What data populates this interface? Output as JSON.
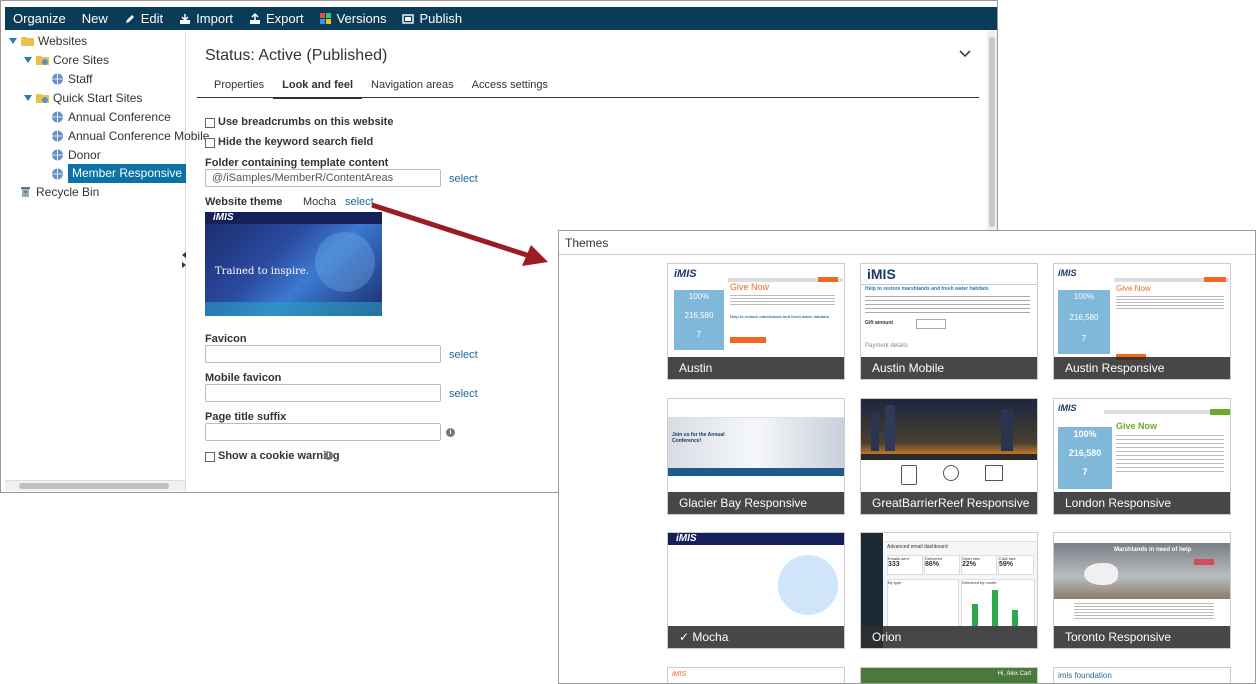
{
  "toolbar": {
    "organize": "Organize",
    "new": "New",
    "edit": "Edit",
    "import": "Import",
    "export": "Export",
    "versions": "Versions",
    "publish": "Publish"
  },
  "tree": {
    "websites": "Websites",
    "core_sites": "Core Sites",
    "staff": "Staff",
    "quick_start_sites": "Quick Start Sites",
    "annual_conference": "Annual Conference",
    "annual_conference_mobile": "Annual Conference Mobile",
    "donor": "Donor",
    "member_responsive": "Member Responsive",
    "recycle_bin": "Recycle Bin"
  },
  "status_title": "Status: Active (Published)",
  "tabs": [
    "Properties",
    "Look and feel",
    "Navigation areas",
    "Access settings"
  ],
  "form": {
    "breadcrumbs_label": "Use breadcrumbs on this website",
    "hide_search_label": "Hide the keyword search field",
    "folder_label": "Folder containing template content",
    "folder_value": "@/iSamples/MemberR/ContentAreas",
    "select": "select",
    "theme_label": "Website theme",
    "theme_value": "Mocha",
    "favicon_label": "Favicon",
    "mobile_favicon_label": "Mobile favicon",
    "page_title_suffix_label": "Page title suffix",
    "cookie_label": "Show a cookie warning"
  },
  "preview": {
    "logo": "iMIS",
    "headline": "Trained to inspire."
  },
  "themes_panel": {
    "title": "Themes",
    "cards": [
      {
        "name": "Austin"
      },
      {
        "name": "Austin Mobile"
      },
      {
        "name": "Austin Responsive"
      },
      {
        "name": "Glacier Bay Responsive"
      },
      {
        "name": "GreatBarrierReef Responsive"
      },
      {
        "name": "London Responsive"
      },
      {
        "name": "✓ Mocha"
      },
      {
        "name": "Orion"
      },
      {
        "name": "Toronto Responsive"
      }
    ],
    "austin": {
      "logo": "iMIS",
      "give_now": "Give Now",
      "stat1": "100%",
      "stat2": "216,580",
      "stat3": "7",
      "help": "Help to restore marshlands and fresh water habitats"
    },
    "austin_mobile": {
      "logo": "iMIS",
      "help": "Help to restore marshlands and fresh water habitats",
      "gift": "Gift amount",
      "payment": "Payment details"
    },
    "london": {
      "give_now": "Give Now",
      "stat1": "100%",
      "stat2": "216,580",
      "stat3": "7"
    },
    "glacier": {
      "banner": "Join us for the Annual Conference!"
    },
    "orion": {
      "title": "Advanced email dashboard",
      "k1_label": "Emails sent",
      "k1": "333",
      "k2_label": "Delivered",
      "k2": "86%",
      "k3_label": "Open rate",
      "k3": "22%",
      "k4_label": "Click rate",
      "k4": "59%",
      "by_type": "By type",
      "by_month": "Delivered by month"
    },
    "toronto": {
      "title": "Marshlands in need of help"
    },
    "bottom_labels": [
      "Hi, Alex  Cart",
      "imis foundation"
    ]
  },
  "colors": {
    "toolbar": "#0a3c5a",
    "selected": "#0b72a3",
    "arrow": "#9b1c22",
    "link": "#1a6aa0",
    "austin_orange": "#f26722",
    "london_green": "#6aab2e"
  }
}
